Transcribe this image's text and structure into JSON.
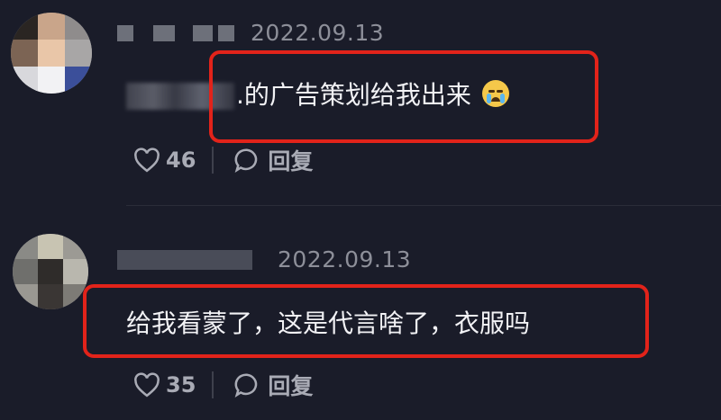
{
  "comments": [
    {
      "date": "2022.09.13",
      "text": ".的广告策划给我出来",
      "emoji": "loudly-crying-face",
      "likes": "46",
      "reply_label": "回复"
    },
    {
      "date": "2022.09.13",
      "text": "给我看蒙了，这是代言啥了，衣服吗",
      "likes": "35",
      "reply_label": "回复"
    }
  ],
  "colors": {
    "background": "#1a1c29",
    "highlight_border": "#e2231a",
    "muted_text": "#8d8f99"
  }
}
